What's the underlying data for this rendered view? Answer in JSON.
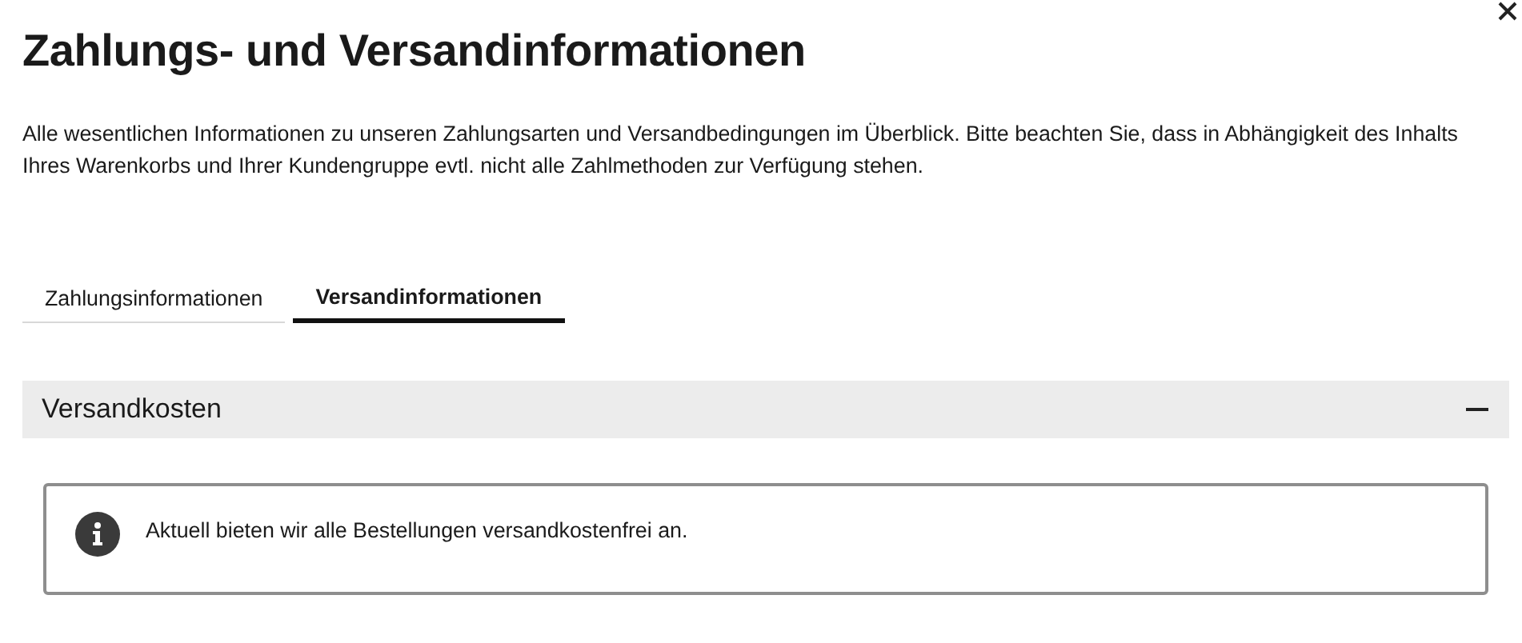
{
  "dialog": {
    "title": "Zahlungs- und Versandinformationen",
    "intro": "Alle wesentlichen Informationen zu unseren Zahlungsarten und Versandbedingungen im Überblick. Bitte beachten Sie, dass in Abhängigkeit des Inhalts Ihres Warenkorbs und Ihrer Kundengruppe evtl. nicht alle Zahlmethoden zur Verfügung stehen."
  },
  "tabs": [
    {
      "label": "Zahlungsinformationen",
      "selected": false
    },
    {
      "label": "Versandinformationen",
      "selected": true
    }
  ],
  "accordion": {
    "title": "Versandkosten",
    "expanded": true,
    "notice": "Aktuell bieten wir alle Bestellungen versandkostenfrei an."
  }
}
